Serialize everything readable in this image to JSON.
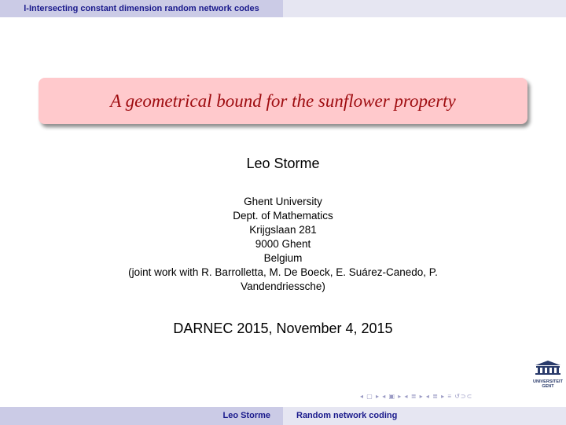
{
  "header": {
    "section_title": "l-Intersecting constant dimension random network codes"
  },
  "slide": {
    "title": "A geometrical bound for the sunflower property",
    "author": "Leo Storme",
    "affiliation_lines": [
      "Ghent University",
      "Dept. of Mathematics",
      "Krijgslaan 281",
      "9000 Ghent",
      "Belgium",
      "(joint work with R. Barrolletta, M. De Boeck, E. Suárez-Canedo, P.",
      "Vandendriessche)"
    ],
    "event": "DARNEC 2015, November 4, 2015"
  },
  "logo": {
    "line1": "UNIVERSITEIT",
    "line2": "GENT",
    "color": "#2a3b6b"
  },
  "navigation": {
    "symbols": "◂ ▢ ▸ ◂ ▣ ▸ ◂ ≣ ▸ ◂ ≣ ▸  ≡  ↺⊃⊂"
  },
  "footer": {
    "author": "Leo Storme",
    "short_title": "Random network coding"
  },
  "colors": {
    "title_bg": "#ffc9cc",
    "title_text": "#9e0b0f",
    "bar_dark": "#cbcbe6",
    "bar_light": "#e6e6f2",
    "bar_text": "#1a1a8c"
  }
}
